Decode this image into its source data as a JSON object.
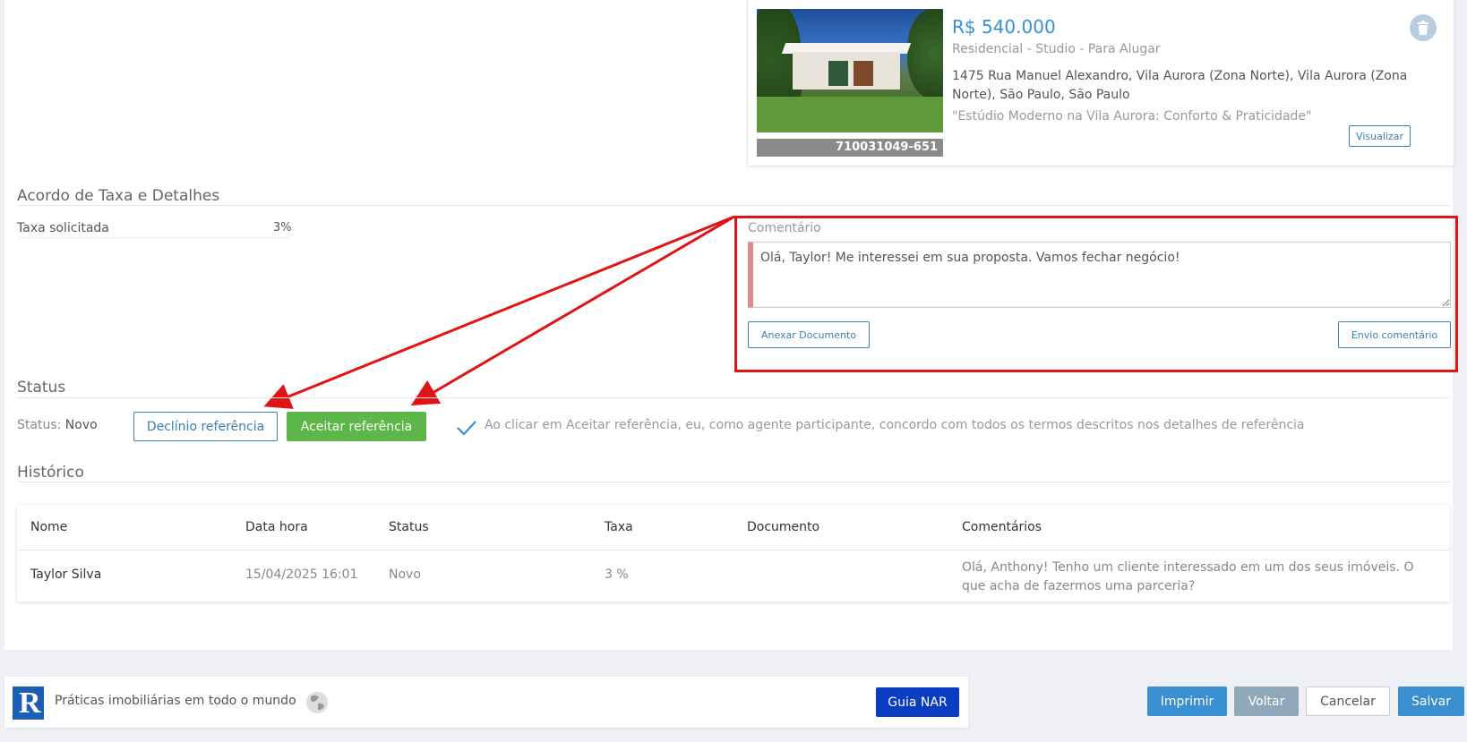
{
  "property": {
    "price": "R$ 540.000",
    "type": "Residencial - Studio - Para Alugar",
    "address": "1475 Rua Manuel Alexandro, Vila Aurora (Zona Norte), Vila Aurora (Zona Norte), São Paulo, São Paulo",
    "title_quote": "\"Estúdio Moderno na Vila Aurora: Conforto & Praticidade\"",
    "listing_id": "710031049-651",
    "view_label": "Visualizar"
  },
  "fee_section": {
    "title": "Acordo de Taxa e Detalhes",
    "fee_label": "Taxa solicitada",
    "fee_value": "3%"
  },
  "comment": {
    "label": "Comentário",
    "value": "Olá, Taylor! Me interessei em sua proposta. Vamos fechar negócio!",
    "attach_label": "Anexar Documento",
    "send_label": "Envio comentário"
  },
  "status_section": {
    "title": "Status",
    "status_prefix": "Status:",
    "status_value": "Novo",
    "decline_label": "Declínio referência",
    "accept_label": "Aceitar referência",
    "accept_note": "Ao clicar em Aceitar referência, eu, como agente participante, concordo com todos os termos descritos nos detalhes de referência"
  },
  "history": {
    "title": "Histórico",
    "columns": [
      "Nome",
      "Data hora",
      "Status",
      "Taxa",
      "Documento",
      "Comentários"
    ],
    "rows": [
      {
        "name": "Taylor Silva",
        "datetime": "15/04/2025 16:01",
        "status": "Novo",
        "fee": "3 %",
        "document": "",
        "comment": "Olá, Anthony! Tenho um cliente interessado em um dos seus imóveis. O que acha de fazermos uma parceria?"
      }
    ]
  },
  "footer": {
    "tagline": "Práticas imobiliárias em todo o mundo",
    "nar_label": "Guia NAR",
    "print_label": "Imprimir",
    "back_label": "Voltar",
    "cancel_label": "Cancelar",
    "save_label": "Salvar"
  },
  "colors": {
    "accent_blue": "#3a8fd1",
    "accept_green": "#5cb748",
    "highlight_red": "#e01414",
    "nar_blue": "#0a3cc2"
  },
  "icons": [
    "trash-icon",
    "checkmark-icon",
    "realtor-logo-icon",
    "globe-icon",
    "red-arrow-annotation"
  ]
}
